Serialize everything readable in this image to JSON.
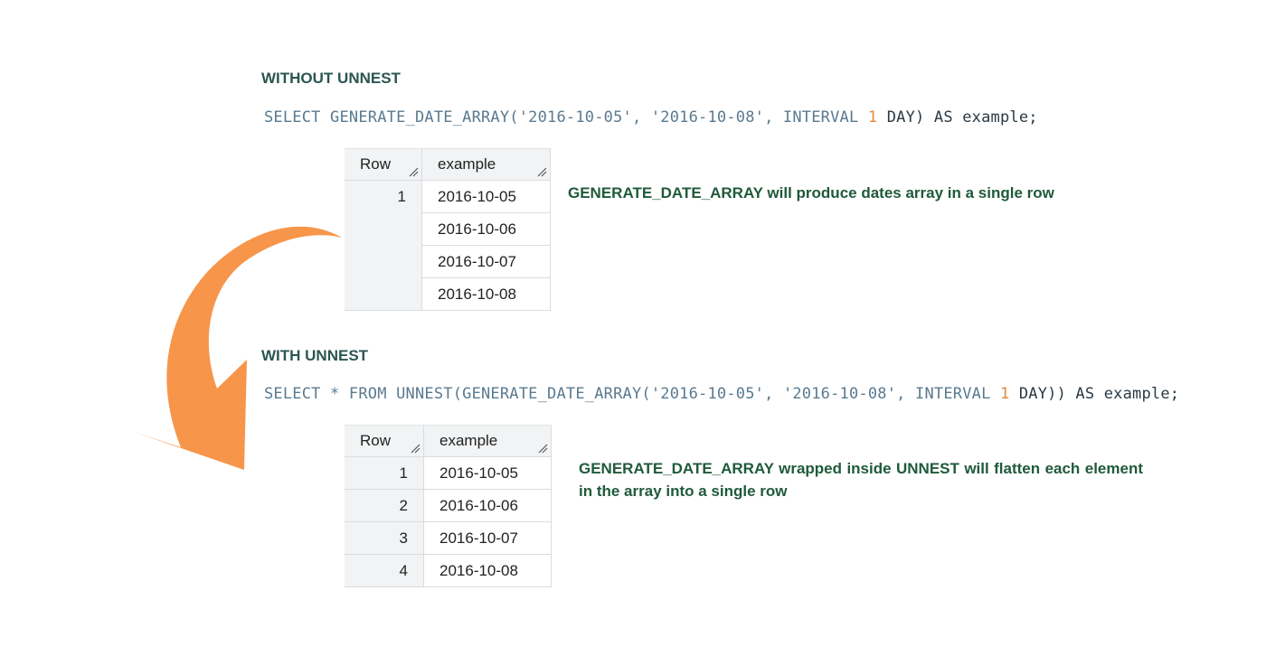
{
  "section_without": {
    "heading": "WITHOUT UNNEST",
    "sql": {
      "p1": "SELECT GENERATE_DATE_ARRAY(",
      "s1": "'2016-10-05'",
      "p2": ", ",
      "s2": "'2016-10-08'",
      "p3": ", INTERVAL ",
      "num": "1",
      "p4": " DAY) AS ",
      "alias": "example",
      "end": ";"
    },
    "table": {
      "col_row": "Row",
      "col_example": "example",
      "row_number": "1",
      "values": [
        "2016-10-05",
        "2016-10-06",
        "2016-10-07",
        "2016-10-08"
      ]
    },
    "note": "GENERATE_DATE_ARRAY will produce  dates array in a single row"
  },
  "section_with": {
    "heading": "WITH UNNEST",
    "sql": {
      "p1": "SELECT * FROM UNNEST(GENERATE_DATE_ARRAY(",
      "s1": "'2016-10-05'",
      "p2": ", ",
      "s2": "'2016-10-08'",
      "p3": ", INTERVAL ",
      "num": "1",
      "p4": " DAY)) AS ",
      "alias": "example",
      "end": ";"
    },
    "table": {
      "col_row": "Row",
      "col_example": "example",
      "rows": [
        {
          "n": "1",
          "v": "2016-10-05"
        },
        {
          "n": "2",
          "v": "2016-10-06"
        },
        {
          "n": "3",
          "v": "2016-10-07"
        },
        {
          "n": "4",
          "v": "2016-10-08"
        }
      ]
    },
    "note": "GENERATE_DATE_ARRAY  wrapped  inside  UNNEST  will  flatten  each element in the array into a single row"
  },
  "colors": {
    "heading": "#2b5650",
    "note": "#1f5a3a",
    "arrow": "#f7954a",
    "number_literal": "#e08a3c"
  },
  "icons": [
    "curved-arrow-icon",
    "column-resize-grip-icon"
  ]
}
